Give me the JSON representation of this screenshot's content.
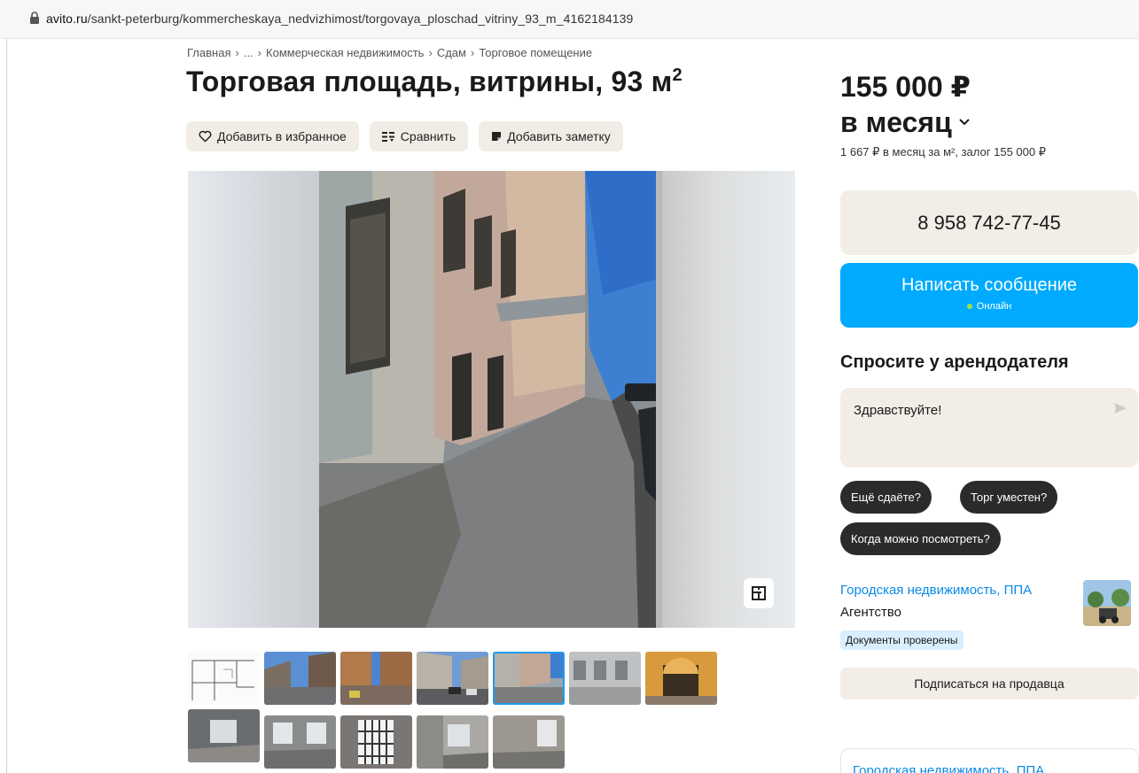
{
  "browser": {
    "url_host": "avito.ru",
    "url_path": "/sankt-peterburg/kommercheskaya_nedvizhimost/torgovaya_ploschad_vitriny_93_m_4162184139"
  },
  "breadcrumb": [
    "Главная",
    "...",
    "Коммерческая недвижимость",
    "Сдам",
    "Торговое помещение"
  ],
  "listing": {
    "title": "Торговая площадь, витрины, 93 м",
    "title_sup": "2",
    "actions": {
      "favorite": "Добавить в избранное",
      "compare": "Сравнить",
      "note": "Добавить заметку"
    }
  },
  "price": {
    "amount": "155 000 ₽",
    "period": "в месяц",
    "details": "1 667 ₽ в месяц за м², залог 155 000 ₽"
  },
  "contact": {
    "phone": "8 958 742-77-45",
    "message_label": "Написать сообщение",
    "online_label": "Онлайн"
  },
  "ask": {
    "title": "Спросите у арендодателя",
    "message": "Здравствуйте!",
    "chips": [
      "Ещё сдаёте?",
      "Торг уместен?",
      "Когда можно посмотреть?"
    ]
  },
  "seller": {
    "name": "Городская недвижимость, ППА",
    "type": "Агентство",
    "badge": "Документы проверены",
    "subscribe": "Подписаться на продавца"
  },
  "bottom_card": {
    "name": "Городская недвижимость, ППА"
  },
  "gallery": {
    "thumbnail_count": 12,
    "active_thumbnail": 5
  },
  "colors": {
    "accent_blue": "#00aaff",
    "link_blue": "#0a8ae6",
    "beige_button": "#f2eee7",
    "chip_dark": "#2b2b2b"
  }
}
